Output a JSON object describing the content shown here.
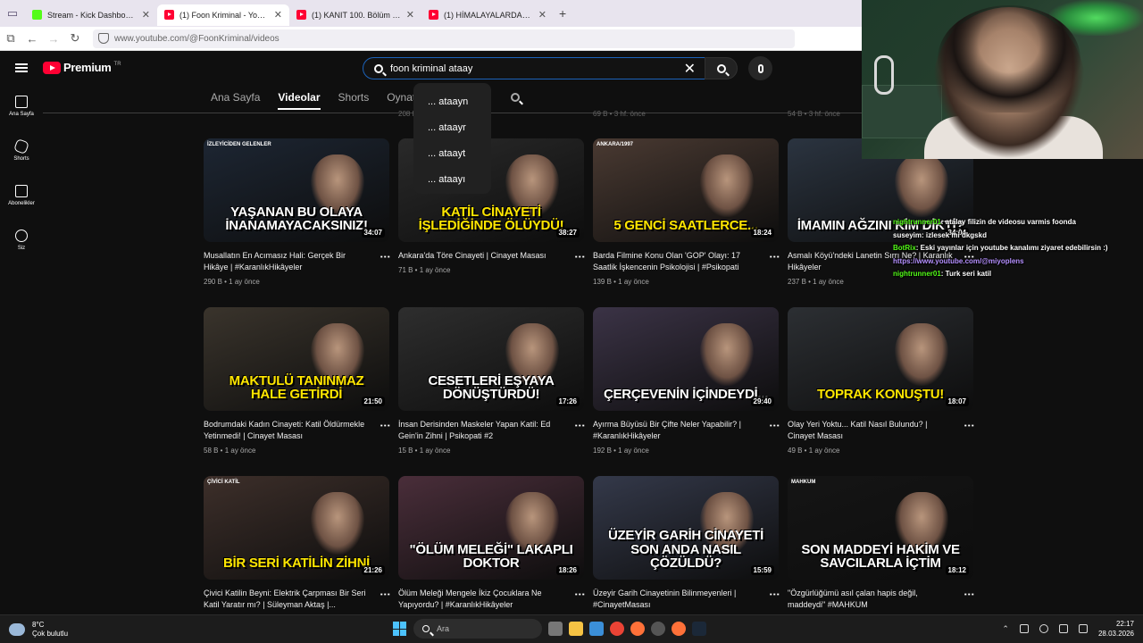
{
  "browser": {
    "tabs": [
      {
        "title": "Stream - Kick Dashboard",
        "favicon": "kick",
        "active": false
      },
      {
        "title": "(1) Foon Kriminal - YouTube",
        "favicon": "youtube",
        "active": true
      },
      {
        "title": "(1) KANIT 100. Bölüm - Full Bölüm",
        "favicon": "youtube",
        "active": false
      },
      {
        "title": "(1) HİMALAYALARDAKİ UÇAK KAZASI",
        "favicon": "youtube",
        "active": false
      }
    ],
    "url": "www.youtube.com/@FoonKriminal/videos"
  },
  "youtube": {
    "logo_text": "Premium",
    "logo_country": "TR",
    "search_value": "foon kriminal ataay",
    "suggestions": [
      "... ataayn",
      "... ataayr",
      "... ataayt",
      "... ataayı"
    ],
    "sidebar": [
      {
        "label": "Ana Sayfa",
        "icon": "home-icon"
      },
      {
        "label": "Shorts",
        "icon": "shorts-icon"
      },
      {
        "label": "Abonelikler",
        "icon": "subscriptions-icon"
      },
      {
        "label": "Siz",
        "icon": "account-icon"
      }
    ],
    "channel_tabs": [
      "Ana Sayfa",
      "Videolar",
      "Shorts",
      "Oynatma listeleri"
    ],
    "active_tab": "Videolar",
    "prev_row_meta": [
      "208 B • 3 hf. önce",
      "69 B • 3 hf. önce",
      "54 B • 3 hf. önce"
    ],
    "videos": [
      {
        "title": "Musallatın En Acımasız Hali: Gerçek Bir Hikâye | #KaranlıkHikâyeler",
        "meta": "290 B • 1 ay önce",
        "duration": "34:07",
        "caption": "YAŞANAN BU OLAYA İNANAMAYACAKSINIZ!",
        "tag": "İZLEYİCİDEN GELENLER",
        "accent": "#ffffff",
        "bg": "#1d2633"
      },
      {
        "title": "Ankara'da Töre Cinayeti | Cinayet Masası",
        "meta": "71 B • 1 ay önce",
        "duration": "38:27",
        "caption": "KATİL CİNAYETİ İŞLEDİĞİNDE ÖLÜYDÜ!",
        "tag": "",
        "accent": "#ffe600",
        "bg": "#2a2a2a"
      },
      {
        "title": "Barda Filmine Konu Olan 'GOP' Olayı: 17 Saatlik İşkencenin Psikolojisi | #Psikopati",
        "meta": "139 B • 1 ay önce",
        "duration": "18:24",
        "caption": "5 GENCİ SAATLERCE...",
        "tag": "ANKARA/1997",
        "accent": "#ffe600",
        "bg": "#4a3a32"
      },
      {
        "title": "Asmalı Köyü'ndeki Lanetin Sırrı Ne? | Karanlık Hikâyeler",
        "meta": "237 B • 1 ay önce",
        "duration": "34:04",
        "caption": "İMAMIN AĞZINI KİM DİKTİ?",
        "tag": "",
        "accent": "#ffffff",
        "bg": "#2b3440"
      },
      {
        "title": "Bodrumdaki Kadın Cinayeti: Katil Öldürmekle Yetinmedi! | Cinayet Masası",
        "meta": "58 B • 1 ay önce",
        "duration": "21:50",
        "caption": "MAKTULÜ TANINMAZ HALE GETİRDİ",
        "tag": "",
        "accent": "#ffe600",
        "bg": "#3a342c"
      },
      {
        "title": "İnsan Derisinden Maskeler Yapan Katil: Ed Gein'in Zihni | Psikopati #2",
        "meta": "15 B • 1 ay önce",
        "duration": "17:26",
        "caption": "CESETLERİ EŞYAYA DÖNÜŞTÜRDÜ!",
        "tag": "",
        "accent": "#ffffff",
        "bg": "#2e2e2e"
      },
      {
        "title": "Ayırma Büyüsü Bir Çifte Neler Yapabilir? | #KaranlıkHikâyeler",
        "meta": "192 B • 1 ay önce",
        "duration": "29:40",
        "caption": "ÇERÇEVENİN İÇİNDEYDİ...",
        "tag": "",
        "accent": "#ffffff",
        "bg": "#3b3346"
      },
      {
        "title": "Olay Yeri Yoktu... Katil Nasıl Bulundu? | Cinayet Masası",
        "meta": "49 B • 1 ay önce",
        "duration": "18:07",
        "caption": "TOPRAK KONUŞTU!",
        "tag": "",
        "accent": "#ffe600",
        "bg": "#2c2f33"
      },
      {
        "title": "Çivici Katilin Beyni: Elektrik Çarpması Bir Seri Katil Yaratır mı? | Süleyman Aktaş |...",
        "meta": "",
        "duration": "21:26",
        "caption": "BİR SERİ KATİLİN ZİHNİ",
        "tag": "ÇİVİCİ KATİL",
        "accent": "#ffe600",
        "bg": "#3d2f2a"
      },
      {
        "title": "Ölüm Meleği Mengele İkiz Çocuklara Ne Yapıyordu? | #KaranlıkHikâyeler",
        "meta": "",
        "duration": "18:26",
        "caption": "\"ÖLÜM MELEĞİ\" LAKAPLI DOKTOR",
        "tag": "",
        "accent": "#ffffff",
        "bg": "#4a2e3a"
      },
      {
        "title": "Üzeyir Garih Cinayetinin Bilinmeyenleri | #CinayetMasası",
        "meta": "",
        "duration": "15:59",
        "caption": "ÜZEYİR GARİH CİNAYETİ SON ANDA NASIL ÇÖZÜLDÜ?",
        "tag": "",
        "accent": "#ffffff",
        "bg": "#34394a"
      },
      {
        "title": "\"Özgürlüğümü asıl çalan hapis değil, maddeydi\" #MAHKUM",
        "meta": "",
        "duration": "18:12",
        "caption": "SON MADDEYİ HAKİM VE SAVCILARLA İÇTİM",
        "tag": "MAHKUM",
        "accent": "#ffffff",
        "bg": "#151515"
      }
    ]
  },
  "chat": [
    {
      "user": "nightrunner01",
      "text": ": atalay filizin de videosu varmis foonda",
      "user_color": "green"
    },
    {
      "user": "suseyim",
      "text": ": izlesek mi dkgskd",
      "user_color": "white"
    },
    {
      "user": "BotRix",
      "text": ": Eski yayınlar için youtube kanalımı ziyaret edebilirsin :)",
      "user_color": "green"
    },
    {
      "user": "",
      "text": "https://www.youtube.com/@miyoplens",
      "user_color": "link"
    },
    {
      "user": "nightrunner01",
      "text": ": Turk seri katil",
      "user_color": "green"
    }
  ],
  "taskbar": {
    "temp": "8°C",
    "weather": "Çok bulutlu",
    "search_placeholder": "Ara",
    "time": "22:17",
    "date": "28.03.2026"
  }
}
